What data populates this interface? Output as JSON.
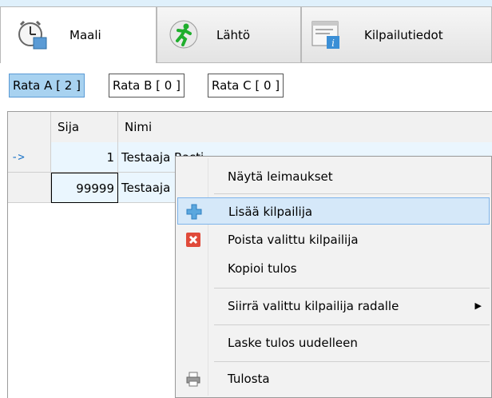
{
  "tabs": [
    {
      "label": "Maali",
      "icon": "stopwatch-icon",
      "active": true
    },
    {
      "label": "Lähtö",
      "icon": "running-man-icon",
      "active": false
    },
    {
      "label": "Kilpailutiedot",
      "icon": "info-window-icon",
      "active": false
    }
  ],
  "ratas": [
    {
      "label": "Rata A  [ 2 ]",
      "selected": true
    },
    {
      "label": "Rata B  [ 0 ]",
      "selected": false
    },
    {
      "label": "Rata C  [ 0 ]",
      "selected": false
    }
  ],
  "grid": {
    "columns": [
      "Sija",
      "Nimi"
    ],
    "rows": [
      {
        "indicator": "->",
        "sija": "1",
        "nimi": "Testaaja Rasti"
      },
      {
        "indicator": "",
        "sija": "99999",
        "nimi": "Testaaja"
      }
    ]
  },
  "context_menu": {
    "items": [
      {
        "label": "Näytä leimaukset",
        "icon": ""
      },
      {
        "label": "Lisää kilpailija",
        "icon": "plus-icon",
        "highlighted": true
      },
      {
        "label": "Poista valittu kilpailija",
        "icon": "delete-x-icon"
      },
      {
        "label": "Kopioi tulos",
        "icon": ""
      },
      {
        "label": "Siirrä valittu kilpailija radalle",
        "icon": "",
        "submenu": true
      },
      {
        "label": "Laske tulos uudelleen",
        "icon": ""
      },
      {
        "label": "Tulosta",
        "icon": "printer-icon"
      }
    ]
  },
  "colors": {
    "accent": "#a8d2f0",
    "highlight": "#d5e8f9",
    "row_bg": "#eaf6fe"
  }
}
